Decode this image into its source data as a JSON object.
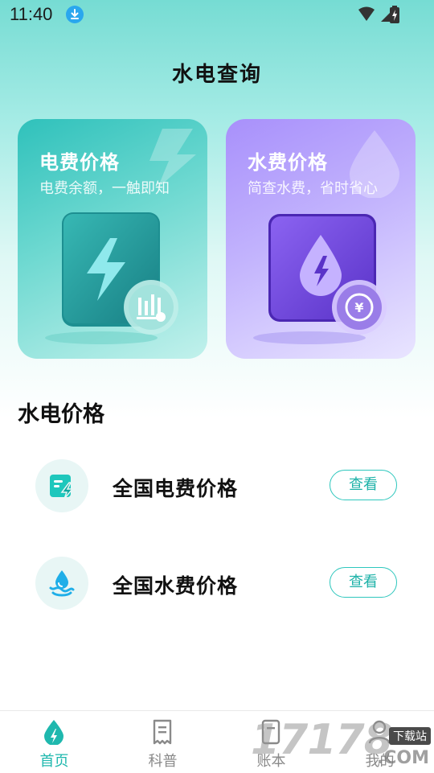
{
  "status_bar": {
    "time": "11:40"
  },
  "header": {
    "title": "水电查询"
  },
  "cards": {
    "electricity": {
      "title": "电费价格",
      "subtitle": "电费余额，一触即知"
    },
    "water": {
      "title": "水费价格",
      "subtitle": "简查水费，省时省心"
    }
  },
  "section": {
    "title": "水电价格",
    "rows": [
      {
        "label": "全国电费价格",
        "button": "查看",
        "icon": "electric-bill-icon"
      },
      {
        "label": "全国水费价格",
        "button": "查看",
        "icon": "water-drop-icon"
      }
    ]
  },
  "nav": {
    "items": [
      {
        "label": "首页",
        "icon": "home-drop-icon",
        "active": true
      },
      {
        "label": "科普",
        "icon": "document-icon",
        "active": false
      },
      {
        "label": "账本",
        "icon": "ledger-icon",
        "active": false
      },
      {
        "label": "我的",
        "icon": "user-icon",
        "active": false
      }
    ]
  },
  "watermark": {
    "text": "17178",
    "tag": "下载站",
    "suffix": ".COM"
  },
  "colors": {
    "accent": "#1fb8ae",
    "elec_card": "#2fc1bb",
    "water_card": "#a890fb"
  }
}
